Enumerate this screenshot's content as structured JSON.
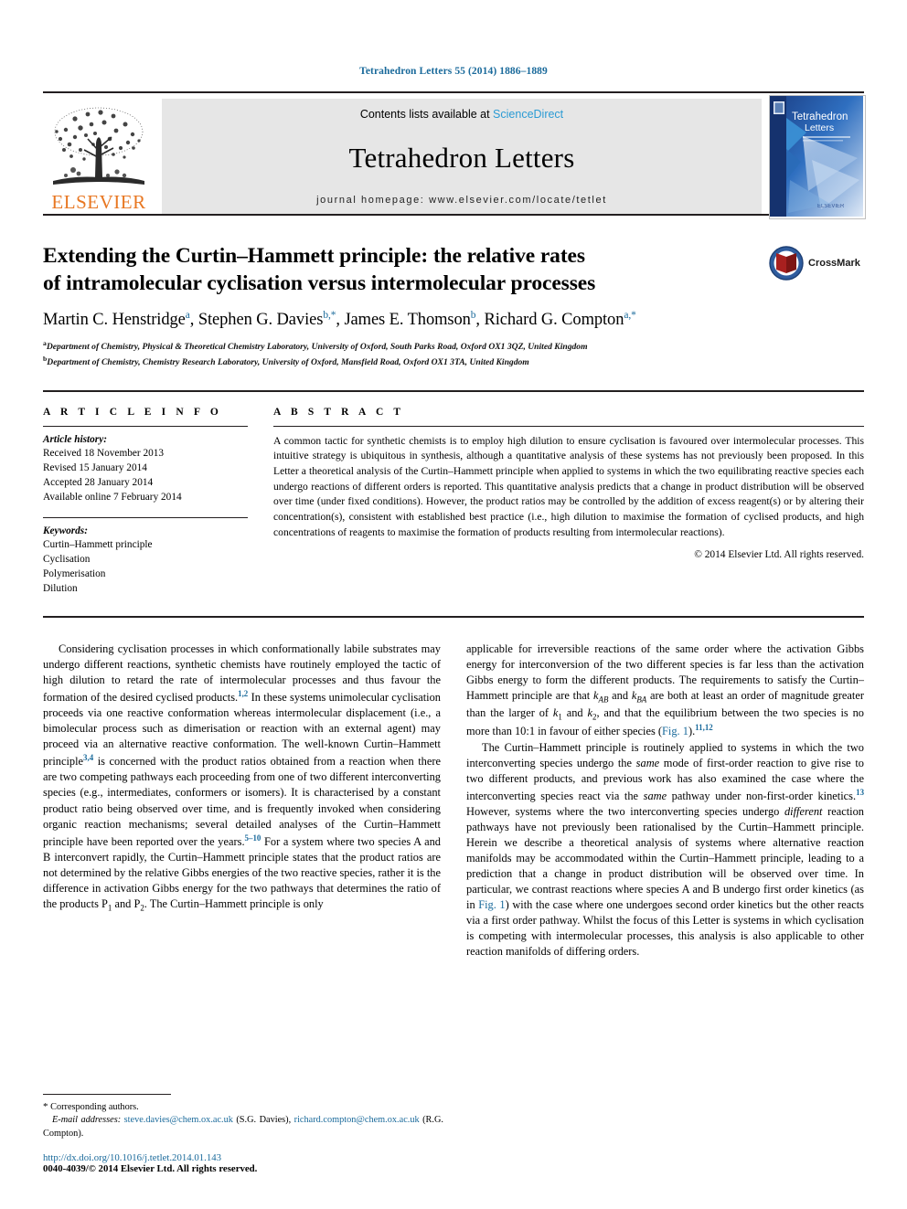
{
  "running_head": "Tetrahedron Letters 55 (2014) 1886–1889",
  "masthead": {
    "publisher": "ELSEVIER",
    "contents_prefix": "Contents lists available at ",
    "contents_link": "ScienceDirect",
    "journal_name": "Tetrahedron Letters",
    "homepage": "journal homepage: www.elsevier.com/locate/tetlet",
    "cover_title_line1": "Tetrahedron",
    "cover_title_line2": "Letters"
  },
  "article": {
    "title_line1": "Extending the Curtin–Hammett principle: the relative rates",
    "title_line2": "of intramolecular cyclisation versus intermolecular processes",
    "crossmark_label": "CrossMark",
    "authors": [
      {
        "name": "Martin C. Henstridge",
        "marks": "a",
        "sep": ", "
      },
      {
        "name": "Stephen G. Davies",
        "marks": "b,*",
        "sep": ", "
      },
      {
        "name": "James E. Thomson",
        "marks": "b",
        "sep": ", "
      },
      {
        "name": "Richard G. Compton",
        "marks": "a,*",
        "sep": ""
      }
    ],
    "affiliations": [
      {
        "mark": "a",
        "text": "Department of Chemistry, Physical & Theoretical Chemistry Laboratory, University of Oxford, South Parks Road, Oxford OX1 3QZ, United Kingdom"
      },
      {
        "mark": "b",
        "text": "Department of Chemistry, Chemistry Research Laboratory, University of Oxford, Mansfield Road, Oxford OX1 3TA, United Kingdom"
      }
    ]
  },
  "article_info": {
    "heading": "A R T I C L E    I N F O",
    "history_label": "Article history:",
    "history": [
      "Received 18 November 2013",
      "Revised 15 January 2014",
      "Accepted 28 January 2014",
      "Available online 7 February 2014"
    ],
    "keywords_label": "Keywords:",
    "keywords": [
      "Curtin–Hammett principle",
      "Cyclisation",
      "Polymerisation",
      "Dilution"
    ]
  },
  "abstract": {
    "heading": "A B S T R A C T",
    "text": "A common tactic for synthetic chemists is to employ high dilution to ensure cyclisation is favoured over intermolecular processes. This intuitive strategy is ubiquitous in synthesis, although a quantitative analysis of these systems has not previously been proposed. In this Letter a theoretical analysis of the Curtin–Hammett principle when applied to systems in which the two equilibrating reactive species each undergo reactions of different orders is reported. This quantitative analysis predicts that a change in product distribution will be observed over time (under fixed conditions). However, the product ratios may be controlled by the addition of excess reagent(s) or by altering their concentration(s), consistent with established best practice (i.e., high dilution to maximise the formation of cyclised products, and high concentrations of reagents to maximise the formation of products resulting from intermolecular reactions).",
    "copyright": "© 2014 Elsevier Ltd. All rights reserved."
  },
  "body": {
    "left_paragraph_1_a": "Considering cyclisation processes in which conformationally labile substrates may undergo different reactions, synthetic chemists have routinely employed the tactic of high dilution to retard the rate of intermolecular processes and thus favour the formation of the desired cyclised products.",
    "left_ref_1": "1,2",
    "left_paragraph_1_b": " In these systems unimolecular cyclisation proceeds via one reactive conformation whereas intermolecular displacement (i.e., a bimolecular process such as dimerisation or reaction with an external agent) may proceed via an alternative reactive conformation. The well-known Curtin–Hammett principle",
    "left_ref_2": "3,4",
    "left_paragraph_1_c": " is concerned with the product ratios obtained from a reaction when there are two competing pathways each proceeding from one of two different interconverting species (e.g., intermediates, conformers or isomers). It is characterised by a constant product ratio being observed over time, and is frequently invoked when considering organic reaction mechanisms; several detailed analyses of the Curtin–Hammett principle have been reported over the years.",
    "left_ref_3": "5–10",
    "left_paragraph_1_d": " For a system where two species A and B interconvert rapidly, the Curtin–Hammett principle states that the product ratios are not determined by the relative Gibbs energies of the two reactive species, rather it is the difference in activation Gibbs energy for the two pathways that determines the ratio of the products P",
    "p1_sub": "1",
    "left_paragraph_1_e": " and P",
    "p2_sub": "2",
    "left_paragraph_1_f": ". The Curtin–Hammett principle is only",
    "right_paragraph_1_a": "applicable for irreversible reactions of the same order where the activation Gibbs energy for interconversion of the two different species is far less than the activation Gibbs energy to form the different products. The requirements to satisfy the Curtin–Hammett principle are that ",
    "k_ab": "k",
    "k_ab_sub": "AB",
    "right_paragraph_1_b": " and ",
    "k_ba": "k",
    "k_ba_sub": "BA",
    "right_paragraph_1_c": " are both at least an order of magnitude greater than the larger of ",
    "k_1": "k",
    "k_1_sub": "1",
    "right_paragraph_1_d": " and ",
    "k_2": "k",
    "k_2_sub": "2",
    "right_paragraph_1_e": ", and that the equilibrium between the two species is no more than 10:1 in favour of either species (",
    "fig_link_1": "Fig. 1",
    "right_paragraph_1_f": ").",
    "right_ref_1": "11,12",
    "right_paragraph_2_a": "The Curtin–Hammett principle is routinely applied to systems in which the two interconverting species undergo the ",
    "same_1": "same",
    "right_paragraph_2_b": " mode of first-order reaction to give rise to two different products, and previous work has also examined the case where the interconverting species react via the ",
    "same_2": "same",
    "right_paragraph_2_c": " pathway under non-first-order kinetics.",
    "right_ref_2": "13",
    "right_paragraph_2_d": " However, systems where the two interconverting species undergo ",
    "different_1": "different",
    "right_paragraph_2_e": " reaction pathways have not previously been rationalised by the Curtin–Hammett principle. Herein we describe a theoretical analysis of systems where alternative reaction manifolds may be accommodated within the Curtin–Hammett principle, leading to a prediction that a change in product distribution will be observed over time. In particular, we contrast reactions where species A and B undergo first order kinetics (as in ",
    "fig_link_2": "Fig. 1",
    "right_paragraph_2_f": ") with the case where one undergoes second order kinetics but the other reacts via a first order pathway. Whilst the focus of this Letter is systems in which cyclisation is competing with intermolecular processes, this analysis is also applicable to other reaction manifolds of differing orders."
  },
  "footnote": {
    "star": "*",
    "corresponding": " Corresponding authors.",
    "email_label": "E-mail addresses:",
    "email_1": "steve.davies@chem.ox.ac.uk",
    "email_1_who": "(S.G. Davies),",
    "email_2": "richard.compton@chem.ox.ac.uk",
    "email_2_who": "(R.G. Compton).",
    "doi": "http://dx.doi.org/10.1016/j.tetlet.2014.01.143",
    "issn": "0040-4039/© 2014 Elsevier Ltd. All rights reserved."
  },
  "colors": {
    "link_blue": "#1a6a9b",
    "sciencedirect_blue": "#2b9bd4",
    "elsevier_orange": "#e87722",
    "banner_grey": "#e6e6e6"
  }
}
